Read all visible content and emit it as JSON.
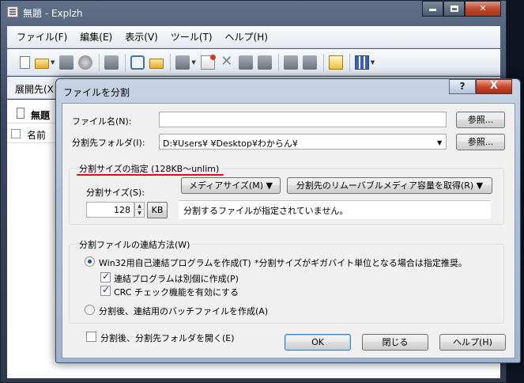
{
  "window": {
    "title": "無題 - Explzh",
    "menu": [
      "ファイル(F)",
      "編集(E)",
      "表示(V)",
      "ツール(T)",
      "ヘルプ(H)"
    ],
    "path_label": "展開先(X",
    "left_pane_title": "無題",
    "column_name": "名前"
  },
  "dialog": {
    "title": "ファイルを分割",
    "help_glyph": "?",
    "close_glyph": "X",
    "filename_label": "ファイル名(N):",
    "filename_value": "",
    "dest_label": "分割先フォルダ(I):",
    "dest_value": "D:¥Users¥                    ¥Desktop¥わからん¥",
    "browse1": "参照...",
    "browse2": "参照...",
    "size_group": {
      "legend": "分割サイズの指定 (128KB〜unlim)",
      "size_label": "分割サイズ(S):",
      "size_value": "128",
      "unit": "KB",
      "media_button": "メディアサイズ(M) ▼",
      "removable_button": "分割先のリムーバブルメディア容量を取得(R) ▼",
      "message": "分割するファイルが指定されていません。"
    },
    "join_group": {
      "legend": "分割ファイルの連結方法(W)",
      "option1": "Win32用自己連結プログラムを作成(T)",
      "option1_note": "*分割サイズがギガバイト単位となる場合は指定推奨。",
      "option1_selected": true,
      "sub1": "連結プログラムは別個に作成(P)",
      "sub1_checked": true,
      "sub2": "CRC チェック機能を有効にする",
      "sub2_checked": true,
      "option2": "分割後、連結用のバッチファイルを作成(A)",
      "option2_selected": false
    },
    "open_after_label": "分割後、分割先フォルダを開く(E)",
    "open_after_checked": false,
    "ok": "OK",
    "close": "閉じる",
    "help": "ヘルプ(H)"
  },
  "colors": {
    "legend_underline": "#d8101a",
    "title_glass": "#aec0d8",
    "close_button": "#c8482c"
  }
}
